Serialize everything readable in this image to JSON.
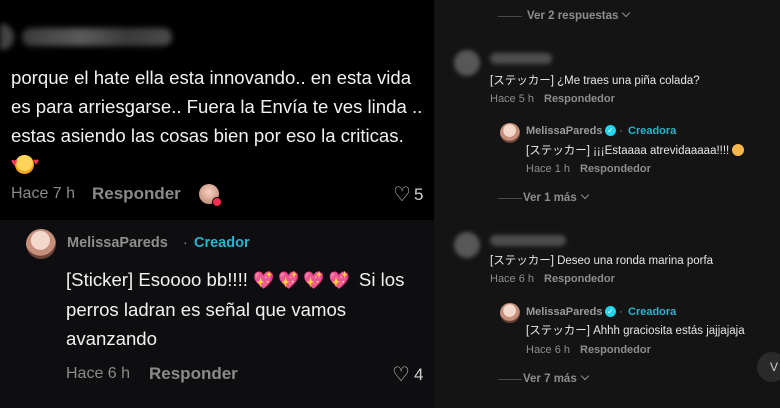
{
  "left": {
    "comment": {
      "author_blurred": "",
      "text": "porque el hate ella esta innovando.. en esta vida es para arriesgarse.. Fuera la Envía te ves linda .. estas asiendo las cosas bien por eso la criticas.",
      "emoji": "smiling-face-with-hearts",
      "time": "Hace 7 h",
      "reply_label": "Responder",
      "likes": "5"
    },
    "reply": {
      "author": "MelissaPareds",
      "separator": "·",
      "badge": "Creador",
      "text_before": "[Sticker] Esoooo bb!!!!",
      "hearts": "💖💖💖💖",
      "text_after": "Si los perros ladran es señal que vamos avanzando",
      "time": "Hace 6 h",
      "reply_label": "Responder",
      "likes": "4"
    }
  },
  "right": {
    "view_more_top": "Ver 2 respuestas",
    "comment1": {
      "text": "[ステッカー] ¿Me traes una piña colada?",
      "time": "Hace 5 h",
      "reply_label": "Respondedor"
    },
    "reply1": {
      "author": "MelissaPareds",
      "separator": "·",
      "badge": "Creadora",
      "text": "[ステッカー] ¡¡¡Estaaaa atrevidaaaaa!!!!",
      "time": "Hace 1 h",
      "reply_label": "Respondedor"
    },
    "view_more_mid": "Ver 1 más",
    "comment2": {
      "text": "[ステッカー] Deseo una ronda marina porfa",
      "time": "Hace 6 h",
      "reply_label": "Respondedor"
    },
    "reply2": {
      "author": "MelissaPareds",
      "separator": "·",
      "badge": "Creadora",
      "text": "[ステッカー] Ahhh graciosita estás jajjajaja",
      "time": "Hace 6 h",
      "reply_label": "Respondedor"
    },
    "view_more_bottom": "Ver 7 más",
    "corner_letter": "V"
  },
  "colors": {
    "creator_badge": "#2ab4cf",
    "verified": "#20d5ec",
    "muted": "#8a8a8a"
  }
}
